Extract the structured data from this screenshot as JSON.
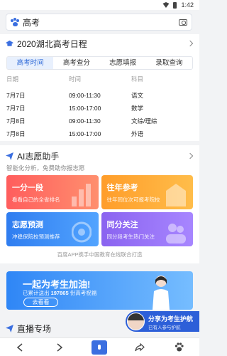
{
  "status_bar": {
    "time": "1:42"
  },
  "search": {
    "query": "高考"
  },
  "schedule": {
    "title": "2020湖北高考日程",
    "tabs": [
      {
        "label": "高考时间",
        "active": true
      },
      {
        "label": "高考查分",
        "active": false
      },
      {
        "label": "志愿填报",
        "active": false
      },
      {
        "label": "录取查询",
        "active": false
      }
    ],
    "columns": [
      "日期",
      "时间",
      "科目"
    ],
    "rows": [
      [
        "7月7日",
        "09:00-11:30",
        "语文"
      ],
      [
        "7月7日",
        "15:00-17:00",
        "数学"
      ],
      [
        "7月8日",
        "09:00-11:30",
        "文综/理综"
      ],
      [
        "7月8日",
        "15:00-17:00",
        "外语"
      ]
    ]
  },
  "assistant": {
    "title": "AI志愿助手",
    "subtitle": "智能化分析，免费助你报志愿",
    "tiles": [
      {
        "title": "一分一段",
        "desc": "看看自己的全省排名",
        "color": "#ff6b5e"
      },
      {
        "title": "往年参考",
        "desc": "往年同位次可报考院校",
        "color": "#ffa934"
      },
      {
        "title": "志愿预测",
        "desc": "冲稳保院校预测推荐",
        "color": "#3a8af3"
      },
      {
        "title": "同分关注",
        "desc": "同分段考生热门关注",
        "color": "#9370f6"
      }
    ],
    "note": "百度APP携手中国教育在线联合打造"
  },
  "banner": {
    "title": "一起为考生加油!",
    "sub_prefix": "已累计送出",
    "sub_count": "197865",
    "sub_suffix": "份高考祝福",
    "button": "去看看"
  },
  "float": {
    "title": "分享为考生护航",
    "sub": "已有人参与护航"
  },
  "live": {
    "title": "直播专场"
  },
  "nav": {
    "items": [
      "back-icon",
      "forward-icon",
      "voice-search-icon",
      "share-icon",
      "home-paw-icon"
    ]
  }
}
